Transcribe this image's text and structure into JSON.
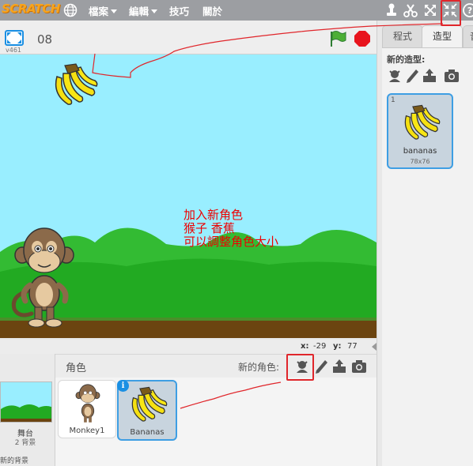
{
  "menubar": {
    "logo": "SCRATCH",
    "menus": [
      {
        "label": "檔案",
        "has_caret": true
      },
      {
        "label": "編輯",
        "has_caret": true
      },
      {
        "label": "技巧",
        "has_caret": false
      },
      {
        "label": "關於",
        "has_caret": false
      }
    ]
  },
  "stage_header": {
    "project_name": "08",
    "version": "v461"
  },
  "stage": {
    "annotation": "加入新角色\n猴子 香蕉\n可以調整角色大小"
  },
  "coords": {
    "x_label": "x:",
    "x_value": "-29",
    "y_label": "y:",
    "y_value": "77"
  },
  "sprites_pane": {
    "header_label": "角色",
    "new_sprite_label": "新的角色:",
    "stage_label": "舞台",
    "stage_backdrops": "2 背景",
    "new_backdrop_label": "新的背景",
    "sprites": [
      {
        "name": "Monkey1",
        "selected": false
      },
      {
        "name": "Bananas",
        "selected": true
      }
    ],
    "info_badge": "i"
  },
  "right_panel": {
    "tabs": [
      {
        "label": "程式",
        "active": false
      },
      {
        "label": "造型",
        "active": true
      },
      {
        "label": "音",
        "active": false
      }
    ],
    "new_costume_label": "新的造型:",
    "costume": {
      "index": "1",
      "name": "bananas",
      "size": "78x76"
    }
  },
  "colors": {
    "menubar": "#9c9ea2",
    "accent_blue": "#3e9ee3",
    "annotation_red": "#e0262b",
    "stage_sky": "#99eeff"
  }
}
